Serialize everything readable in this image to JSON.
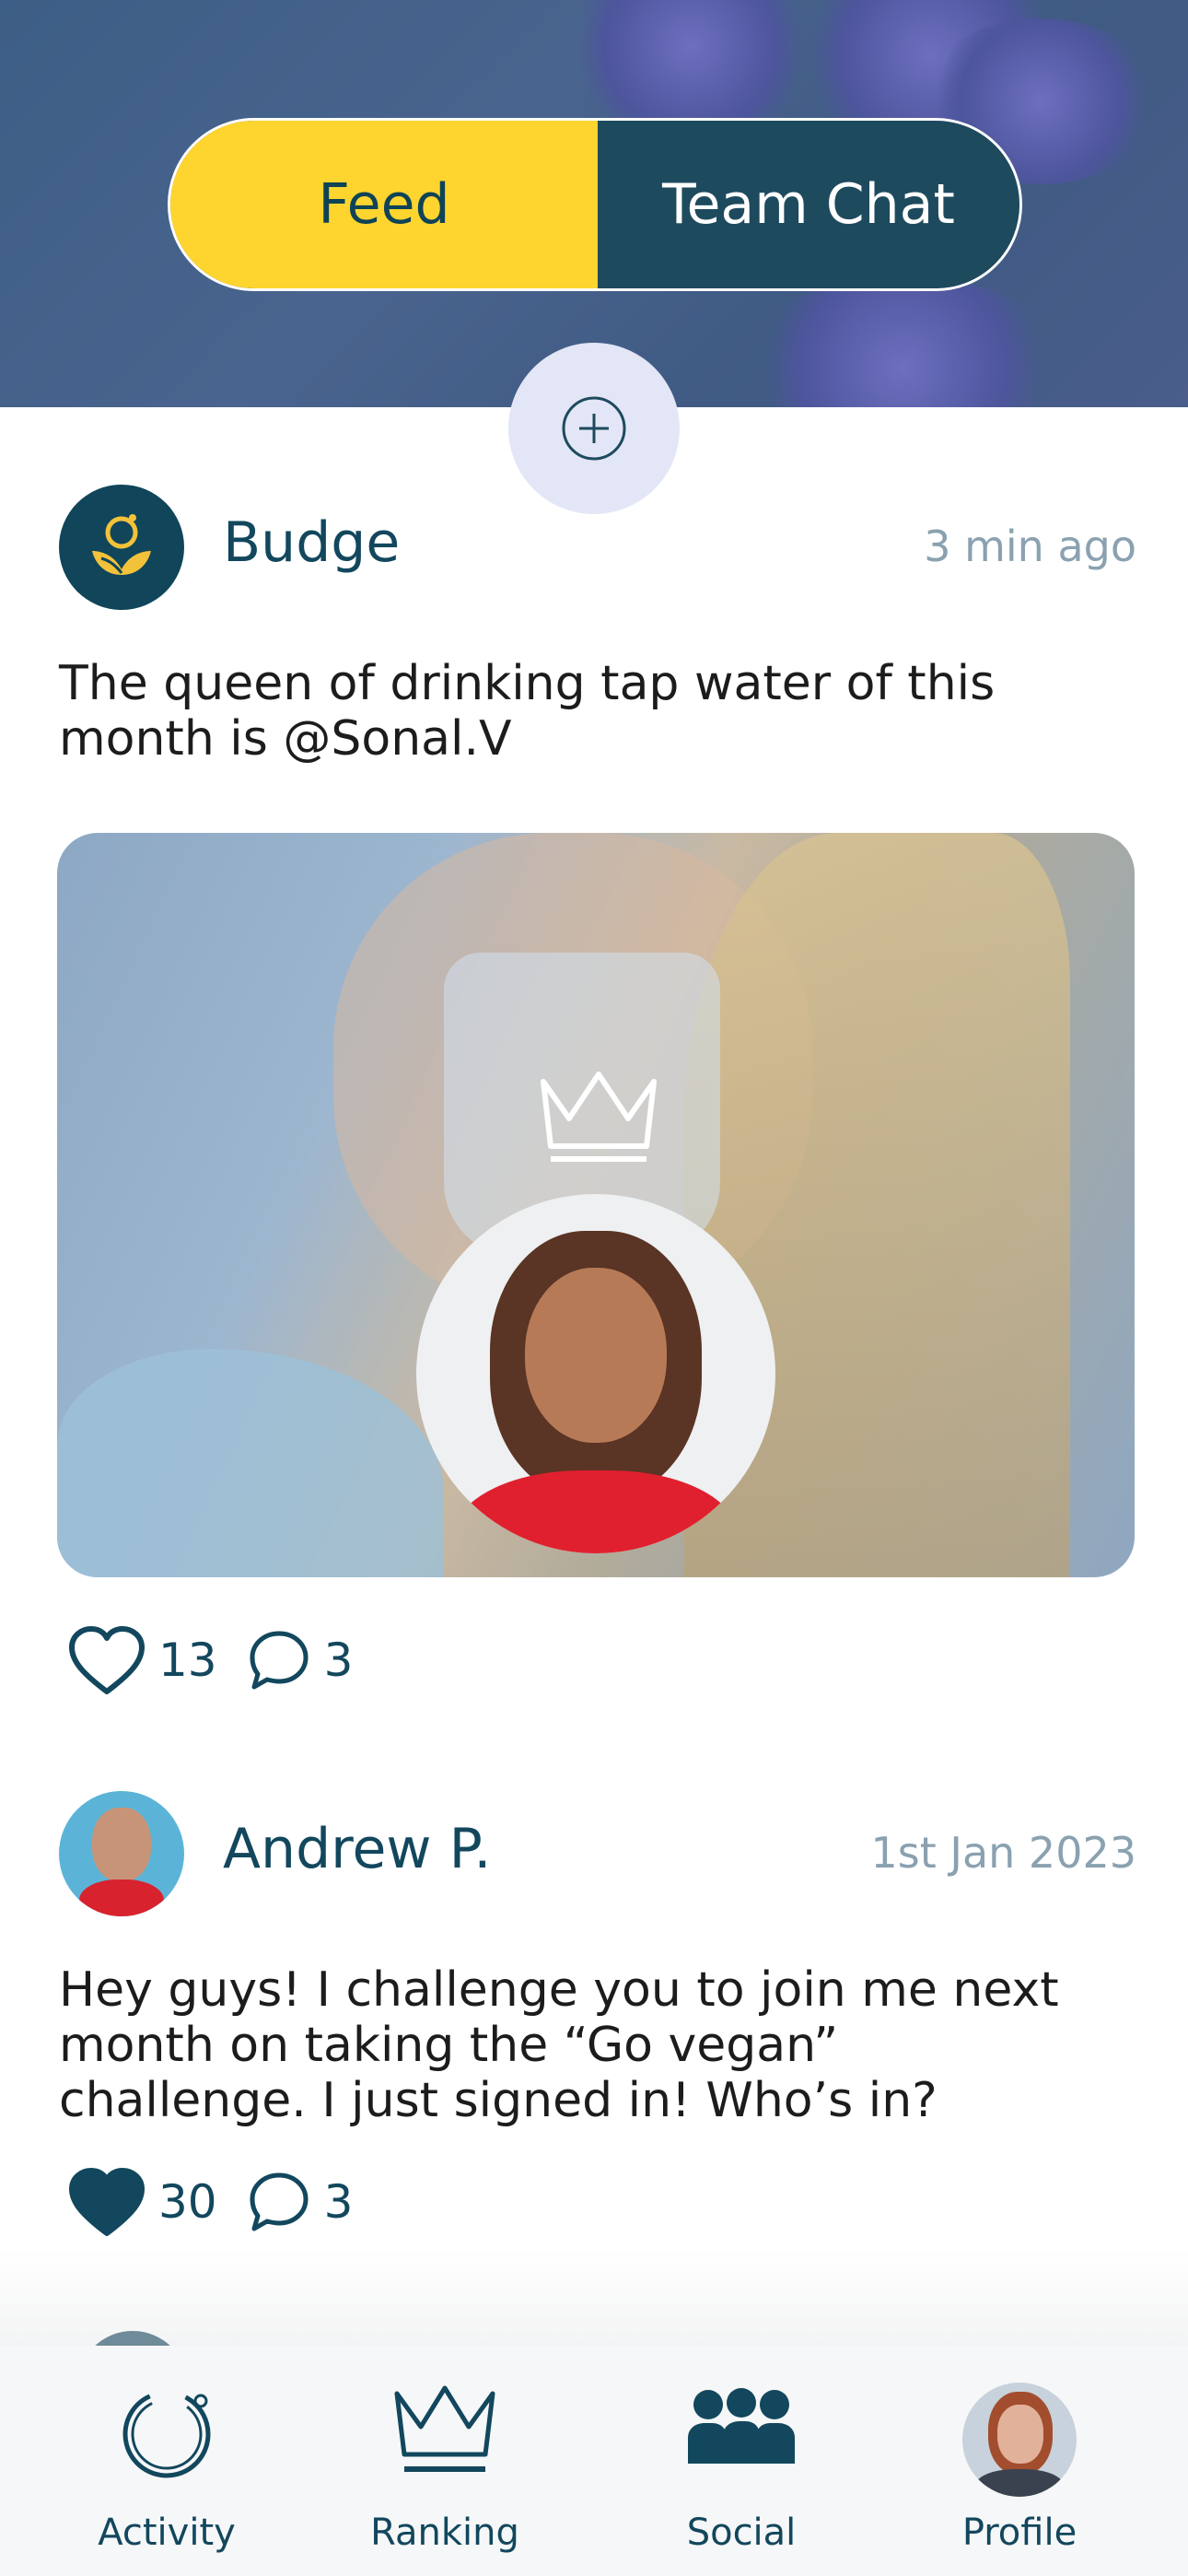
{
  "header": {
    "tabs": [
      {
        "label": "Feed",
        "active": true
      },
      {
        "label": "Team Chat",
        "active": false
      }
    ],
    "add_icon": "plus-circle-icon"
  },
  "posts": [
    {
      "author": "Budge",
      "time": "3 min ago",
      "text_lines": [
        "The queen of drinking tap water of this",
        "month is @Sonal.V"
      ],
      "has_image": true,
      "image_badge_icon": "crown-icon",
      "likes": "13",
      "comments": "3",
      "liked": false
    },
    {
      "author": "Andrew P.",
      "time": "1st Jan 2023",
      "text_lines": [
        "Hey guys! I challenge you to join me next",
        "month on taking the “Go vegan”",
        "challenge. I just signed in! Who’s in?"
      ],
      "has_image": false,
      "likes": "30",
      "comments": "3",
      "liked": true
    }
  ],
  "tabbar": [
    {
      "label": "Activity",
      "icon": "activity-ring-icon"
    },
    {
      "label": "Ranking",
      "icon": "crown-icon"
    },
    {
      "label": "Social",
      "icon": "group-icon"
    },
    {
      "label": "Profile",
      "icon": "profile-avatar"
    }
  ],
  "colors": {
    "accent_yellow": "#fed52f",
    "teal_dark": "#12475d",
    "header_blue": "#48658d"
  }
}
